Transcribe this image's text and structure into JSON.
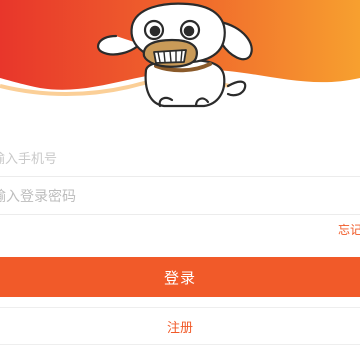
{
  "header": {
    "brand_gradient": [
      "#e8362b",
      "#f7a52f"
    ],
    "mascot": "dog-mascot"
  },
  "form": {
    "phone_placeholder": "输入手机号",
    "password_placeholder": "输入登录密码",
    "forgot_label": "忘记密码"
  },
  "actions": {
    "login_label": "登录",
    "register_label": "注册"
  },
  "colors": {
    "accent": "#f15a29"
  }
}
